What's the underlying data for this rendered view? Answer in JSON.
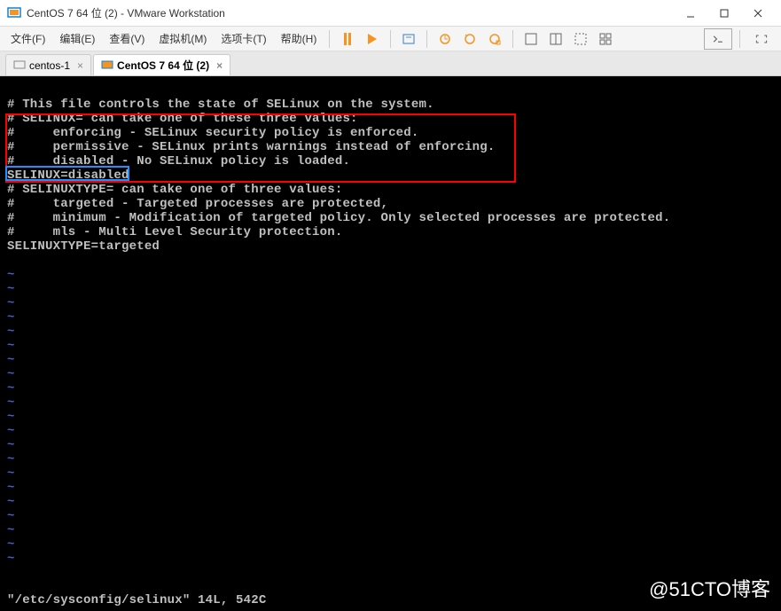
{
  "window": {
    "title": "CentOS 7 64 位 (2) - VMware Workstation"
  },
  "menu": {
    "file": "文件(F)",
    "edit": "编辑(E)",
    "view": "查看(V)",
    "vm": "虚拟机(M)",
    "tabs": "选项卡(T)",
    "help": "帮助(H)"
  },
  "tabs": [
    {
      "label": "centos-1",
      "active": false
    },
    {
      "label": "CentOS 7 64 位 (2)",
      "active": true
    }
  ],
  "terminal": {
    "lines": [
      "# This file controls the state of SELinux on the system.",
      "# SELINUX= can take one of these three values:",
      "#     enforcing - SELinux security policy is enforced.",
      "#     permissive - SELinux prints warnings instead of enforcing.",
      "#     disabled - No SELinux policy is loaded.",
      "SELINUX=disabled",
      "# SELINUXTYPE= can take one of three values:",
      "#     targeted - Targeted processes are protected,",
      "#     minimum - Modification of targeted policy. Only selected processes are protected.",
      "#     mls - Multi Level Security protection.",
      "SELINUXTYPE=targeted"
    ],
    "tilde": "~",
    "status": "\"/etc/sysconfig/selinux\" 14L, 542C"
  },
  "watermark": "@51CTO博客"
}
